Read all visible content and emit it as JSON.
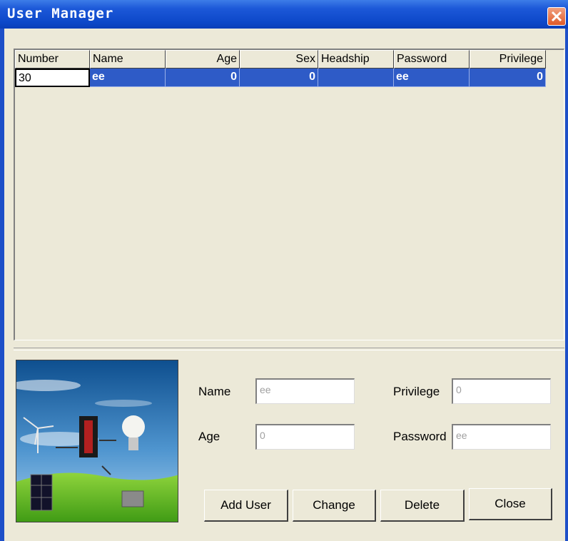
{
  "window": {
    "title": "User Manager"
  },
  "grid": {
    "columns": [
      "Number",
      "Name",
      "Age",
      "Sex",
      "Headship",
      "Password",
      "Privilege"
    ],
    "rows": [
      {
        "number": "30",
        "name": "ee",
        "age": "0",
        "sex": "0",
        "headship": "",
        "password": "ee",
        "privilege": "0"
      }
    ]
  },
  "form": {
    "name_label": "Name",
    "name_value": "ee",
    "age_label": "Age",
    "age_value": "0",
    "privilege_label": "Privilege",
    "privilege_value": "0",
    "password_label": "Password",
    "password_value": "ee"
  },
  "buttons": {
    "add": "Add User",
    "change": "Change",
    "delete": "Delete",
    "close": "Close"
  },
  "colors": {
    "titlebar": "#0c47c8",
    "selection": "#2e5bc7",
    "dialog": "#ece9d8"
  },
  "icons": {
    "close": "close-icon"
  }
}
